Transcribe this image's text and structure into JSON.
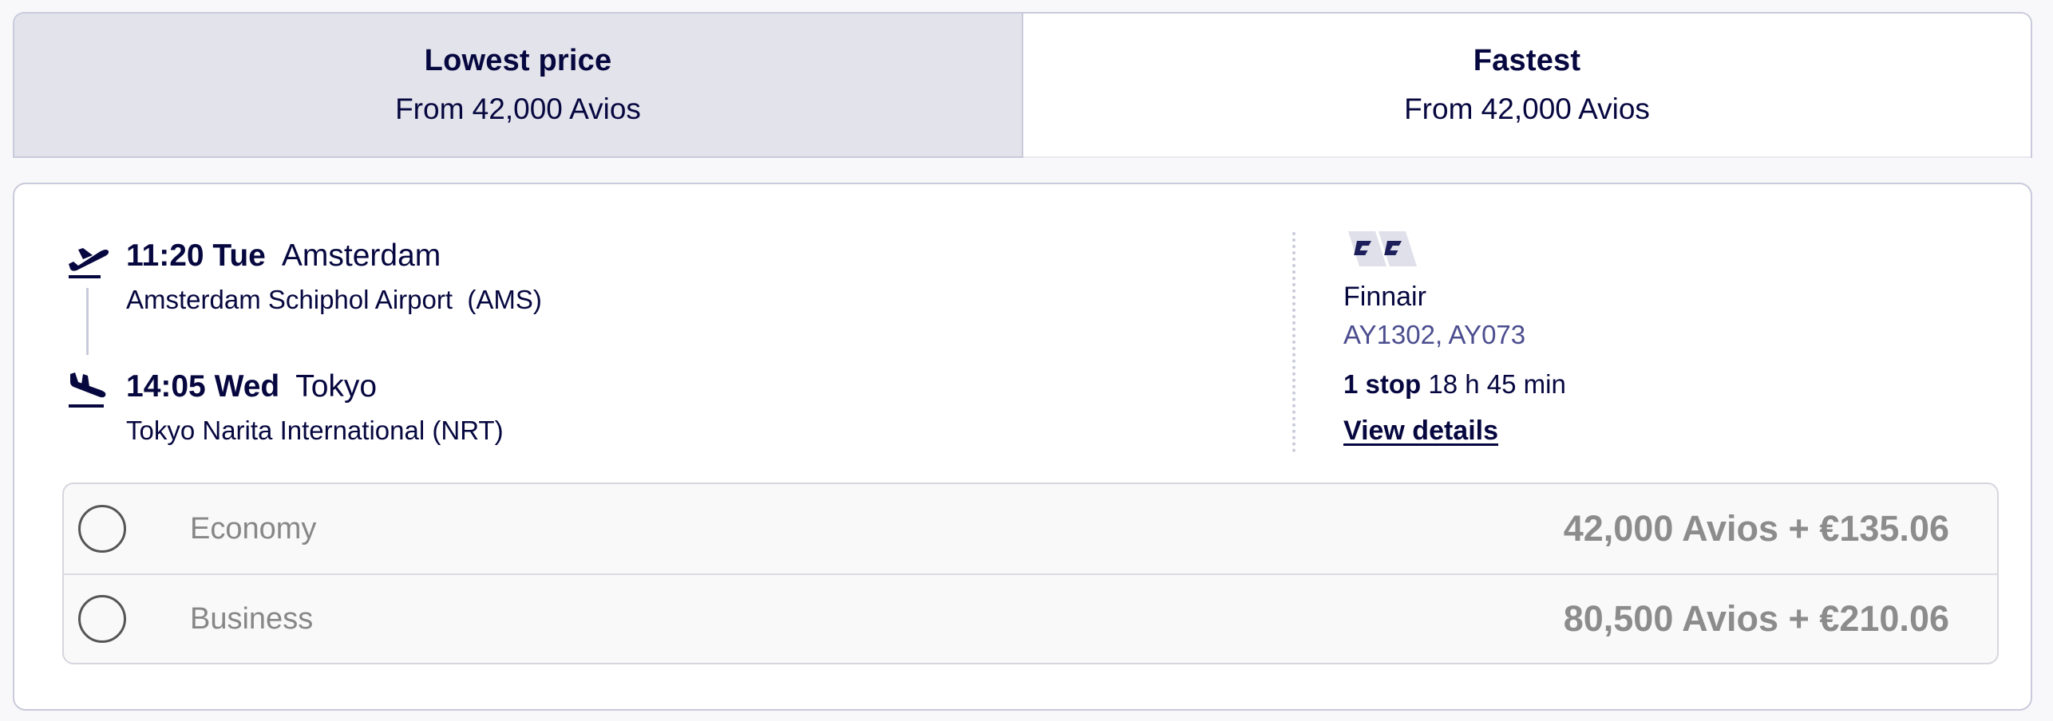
{
  "sort_tabs": [
    {
      "title": "Lowest price",
      "subtitle": "From 42,000 Avios",
      "selected": true
    },
    {
      "title": "Fastest",
      "subtitle": "From 42,000 Avios",
      "selected": false
    }
  ],
  "flight": {
    "departure": {
      "time": "11:20 Tue",
      "city": "Amsterdam",
      "airport": "Amsterdam Schiphol Airport  (AMS)"
    },
    "arrival": {
      "time": "14:05 Wed",
      "city": "Tokyo",
      "airport": "Tokyo Narita International (NRT)"
    },
    "airline": {
      "name": "Finnair",
      "flight_numbers": "AY1302, AY073",
      "logo_icon": "finnair-logo"
    },
    "stops_label": "1 stop",
    "duration": "18 h 45 min",
    "view_details_label": "View details"
  },
  "fares": [
    {
      "cabin": "Economy",
      "price": "42,000 Avios + €135.06",
      "selected": false
    },
    {
      "cabin": "Business",
      "price": "80,500 Avios + €210.06",
      "selected": false
    }
  ],
  "colors": {
    "brand_navy": "#06073f",
    "selected_tab_bg": "#e3e3ec",
    "border": "#c9cadb",
    "flight_number_text": "#4b4d8f",
    "fare_text_muted": "#8c8c8c"
  },
  "icons": {
    "departure": "plane-takeoff-icon",
    "arrival": "plane-landing-icon",
    "radio": "radio-unchecked-icon"
  }
}
